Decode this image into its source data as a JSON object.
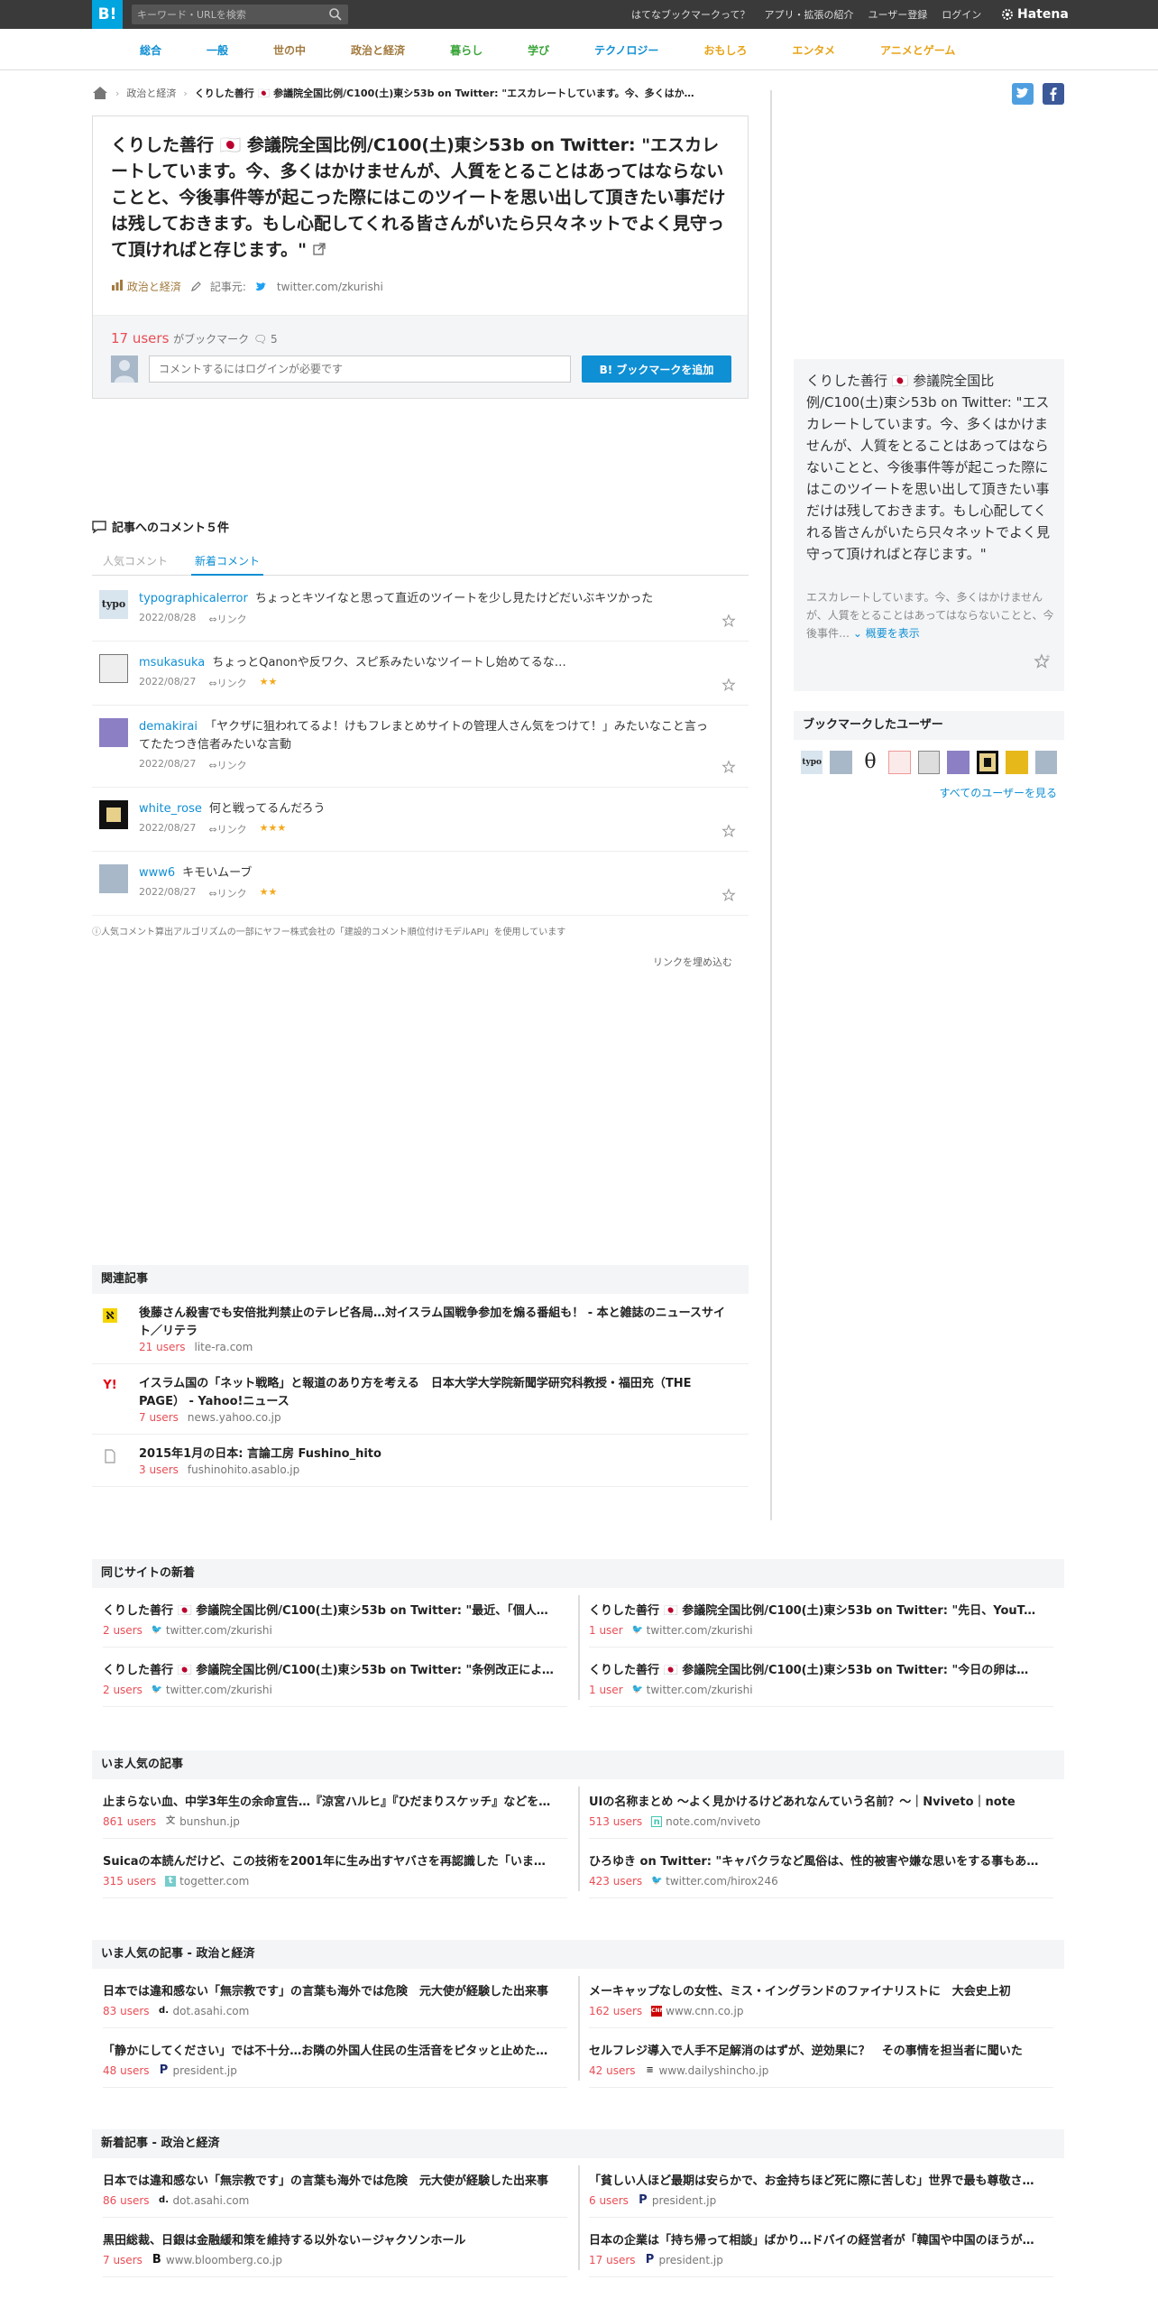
{
  "header": {
    "logo": "B!",
    "search_placeholder": "キーワード・URLを検索",
    "links": [
      "はてなブックマークって？",
      "アプリ・拡張の紹介",
      "ユーザー登録",
      "ログイン"
    ],
    "brand": "Hatena"
  },
  "categories": [
    {
      "label": "総合",
      "color": "#0f8fd4"
    },
    {
      "label": "一般",
      "color": "#0f8fd4"
    },
    {
      "label": "世の中",
      "color": "#a27a3e"
    },
    {
      "label": "政治と経済",
      "color": "#a27a3e"
    },
    {
      "label": "暮らし",
      "color": "#3aa53a"
    },
    {
      "label": "学び",
      "color": "#3aa53a"
    },
    {
      "label": "テクノロジー",
      "color": "#0f8fd4"
    },
    {
      "label": "おもしろ",
      "color": "#e8a317"
    },
    {
      "label": "エンタメ",
      "color": "#e8a317"
    },
    {
      "label": "アニメとゲーム",
      "color": "#e8a317"
    }
  ],
  "breadcrumb": {
    "category": "政治と経済",
    "current": "くりした善行 🇯🇵 参議院全国比例/C100(土)東シ53b on Twitter: \"エスカレートしています。今、多くはか…"
  },
  "entry": {
    "title": "くりした善行 🇯🇵 参議院全国比例/C100(土)東シ53b on Twitter: \"エスカレートしています。今、多くはかけませんが、人質をとることはあってはならないことと、今後事件等が起こった際にはこのツイートを思い出して頂きたい事だけは残しておきます。もし心配してくれる皆さんがいたら只々ネットでよく見守って頂ければと存じます。\"",
    "category": "政治と経済",
    "source_label": "記事元:",
    "source": "twitter.com/zkurishi",
    "users_count": "17 users",
    "users_suffix": "がブックマーク",
    "comment_count": "5",
    "comment_placeholder": "コメントするにはログインが必要です",
    "add_button": "B! ブックマークを追加"
  },
  "summary": {
    "title": "くりした善行 🇯🇵 参議院全国比例/C100(土)東シ53b on Twitter: \"エスカレートしています。今、多くはかけませんが、人質をとることはあってはならないことと、今後事件等が起こった際にはこのツイートを思い出して頂きたい事だけは残しておきます。もし心配してくれる皆さんがいたら只々ネットでよく見守って頂ければと存じます。\"",
    "snippet": "エスカレートしています。今、多くはかけませんが、人質をとることはあってはならないことと、今後事件…",
    "more": "概要を表示"
  },
  "bookmark_users": {
    "heading": "ブックマークしたユーザー",
    "see_all": "すべてのユーザーを見る"
  },
  "comments_section": {
    "heading": "記事へのコメント５件",
    "tab_popular": "人気コメント",
    "tab_new": "新着コメント",
    "items": [
      {
        "user": "typographicalerror",
        "text": "ちょっとキツイなと思って直近のツイートを少し見たけどだいぶキツかった",
        "date": "2022/08/28",
        "link": "リンク",
        "stars": ""
      },
      {
        "user": "msukasuka",
        "text": "ちょっとQanonや反ワク、スピ系みたいなツイートし始めてるな…",
        "date": "2022/08/27",
        "link": "リンク",
        "stars": "★★"
      },
      {
        "user": "demakirai",
        "text": "「ヤクザに狙われてるよ！けもフレまとめサイトの管理人さん気をつけて！」みたいなこと言ってたたつき信者みたいな言動",
        "date": "2022/08/27",
        "link": "リンク",
        "stars": ""
      },
      {
        "user": "white_rose",
        "text": "何と戦ってるんだろう",
        "date": "2022/08/27",
        "link": "リンク",
        "stars": "★★★"
      },
      {
        "user": "www6",
        "text": "キモいムーブ",
        "date": "2022/08/27",
        "link": "リンク",
        "stars": "★★"
      }
    ],
    "notice": "人気コメント算出アルゴリズムの一部にヤフー株式会社の「建設的コメント順位付けモデルAPI」を使用しています",
    "embed": "リンクを埋め込む"
  },
  "related": {
    "heading": "関連記事",
    "items": [
      {
        "title": "後藤さん殺害でも安倍批判禁止のテレビ各局…対イスラム国戦争参加を煽る番組も！ - 本と雑誌のニュースサイト／リテラ",
        "users": "21 users",
        "domain": "lite-ra.com"
      },
      {
        "title": "イスラム国の「ネット戦略」と報道のあり方を考える　日本大学大学院新聞学研究科教授・福田充（THE PAGE） - Yahoo!ニュース",
        "users": "7 users",
        "domain": "news.yahoo.co.jp"
      },
      {
        "title": "2015年1月の日本: 言論工房 Fushino_hito",
        "users": "3 users",
        "domain": "fushinohito.asablo.jp"
      }
    ]
  },
  "same_site": {
    "heading": "同じサイトの新着",
    "items": [
      {
        "title": "くりした善行 🇯🇵 参議院全国比例/C100(土)東シ53b on Twitter: \"最近、「個人情報",
        "users": "2 users",
        "domain": "twitter.com/zkurishi"
      },
      {
        "title": "くりした善行 🇯🇵 参議院全国比例/C100(土)東シ53b on Twitter: \"先日、YouTubeで",
        "users": "1 user",
        "domain": "twitter.com/zkurishi"
      },
      {
        "title": "くりした善行 🇯🇵 参議院全国比例/C100(土)東シ53b on Twitter: \"条例改正によって",
        "users": "2 users",
        "domain": "twitter.com/zkurishi"
      },
      {
        "title": "くりした善行 🇯🇵 参議院全国比例/C100(土)東シ53b on Twitter: \"今日の卵は一個",
        "users": "1 user",
        "domain": "twitter.com/zkurishi"
      }
    ]
  },
  "popular": {
    "heading": "いま人気の記事",
    "items": [
      {
        "title": "止まらない血、中学3年生の余命宣告…『涼宮ハルヒ』『ひだまりスケッチ』などを手がけた",
        "users": "861 users",
        "domain": "bunshun.jp"
      },
      {
        "title": "UIの名称まとめ 〜よく見かけるけどあれなんていう名前？〜｜Nviveto｜note",
        "users": "513 users",
        "domain": "note.com/nviveto"
      },
      {
        "title": "Suicaの本読んだけど、この技術を2001年に生み出すヤバさを再認識した「いまさらだけど",
        "users": "315 users",
        "domain": "togetter.com"
      },
      {
        "title": "ひろゆき on Twitter: \"キャバクラなど風俗は、性的被害や嫌な思いをする事もあると",
        "users": "423 users",
        "domain": "twitter.com/hirox246"
      }
    ]
  },
  "popular_politics": {
    "heading": "いま人気の記事 - 政治と経済",
    "items": [
      {
        "title": "日本では違和感ない「無宗教です」の言葉も海外では危険　元大使が経験した出来事",
        "users": "83 users",
        "domain": "dot.asahi.com"
      },
      {
        "title": "メーキャップなしの女性、ミス・イングランドのファイナリストに　大会史上初",
        "users": "162 users",
        "domain": "www.cnn.co.jp"
      },
      {
        "title": "「静かにしてください」では不十分…お隣の外国人住民の生活音をピタッと止めた方法",
        "users": "48 users",
        "domain": "president.jp"
      },
      {
        "title": "セルフレジ導入で人手不足解消のはずが、逆効果に？　その事情を担当者に聞いた",
        "users": "42 users",
        "domain": "www.dailyshincho.jp"
      }
    ]
  },
  "new_politics": {
    "heading": "新着記事 - 政治と経済",
    "items": [
      {
        "title": "日本では違和感ない「無宗教です」の言葉も海外では危険　元大使が経験した出来事",
        "users": "86 users",
        "domain": "dot.asahi.com"
      },
      {
        "title": "「貧しい人ほど最期は安らかで、お金持ちほど死に際に苦しむ」世界で最も尊敬される",
        "users": "6 users",
        "domain": "president.jp"
      },
      {
        "title": "黒田総裁、日銀は金融緩和策を維持する以外ない－ジャクソンホール",
        "users": "7 users",
        "domain": "www.bloomberg.co.jp"
      },
      {
        "title": "日本の企業は「持ち帰って相談」ばかり…ドバイの経営者が「韓国や中国のほうがいい」",
        "users": "17 users",
        "domain": "president.jp"
      }
    ]
  },
  "colors": {
    "accent": "#0f8fd4",
    "users": "#e94d55",
    "topbar": "#3a3a3a"
  }
}
